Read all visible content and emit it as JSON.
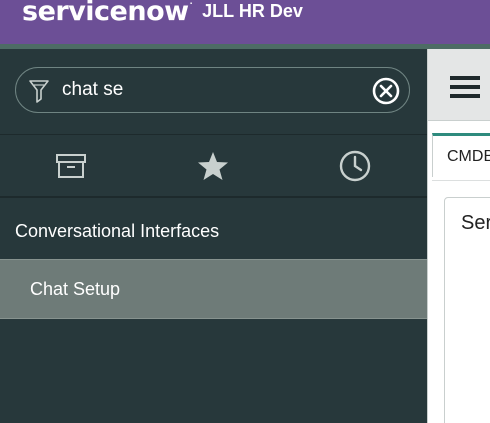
{
  "banner": {
    "logo_text": "servicenow",
    "logo_mark": ".",
    "instance_name": "JLL HR Dev",
    "bg_color": "#6c4f96"
  },
  "navigator": {
    "filter_value": "chat se",
    "filter_icon": "funnel-icon",
    "clear_icon": "circle-x-icon",
    "tabs": [
      {
        "icon": "archive-box-icon"
      },
      {
        "icon": "star-icon"
      },
      {
        "icon": "clock-icon"
      }
    ],
    "application": "Conversational Interfaces",
    "module": "Chat Setup",
    "bg_color": "#27383b",
    "selected_color": "#6e7b78"
  },
  "content": {
    "menu_icon": "hamburger-icon",
    "tab_label": "CMDB",
    "card_title": "Ser",
    "accent_color": "#2e8b7e"
  }
}
